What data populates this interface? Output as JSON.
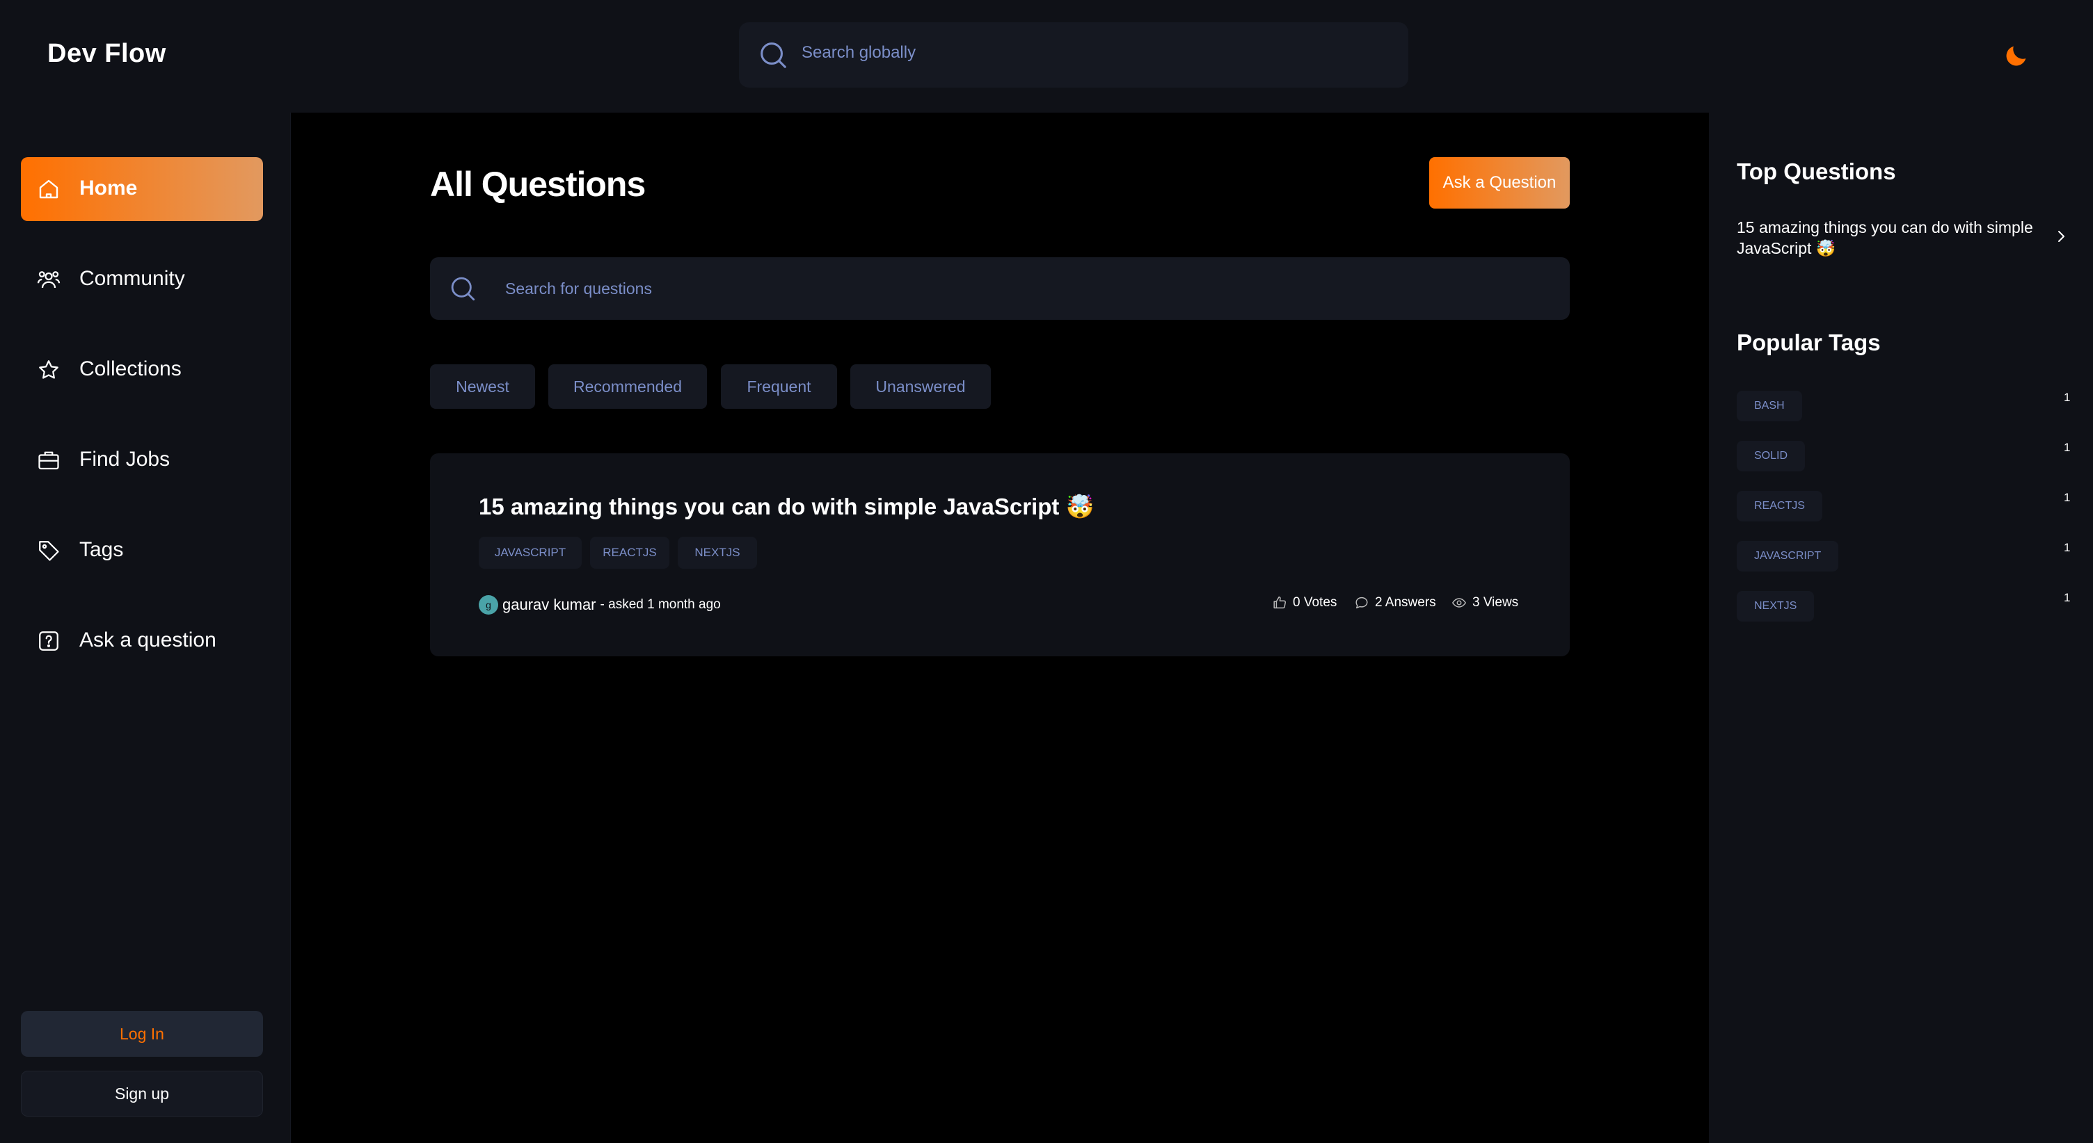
{
  "app": {
    "name": "Dev Flow"
  },
  "header": {
    "search_placeholder": "Search globally"
  },
  "sidebar": {
    "items": [
      {
        "label": "Home",
        "icon": "home-icon",
        "active": true
      },
      {
        "label": "Community",
        "icon": "users-icon",
        "active": false
      },
      {
        "label": "Collections",
        "icon": "star-icon",
        "active": false
      },
      {
        "label": "Find Jobs",
        "icon": "briefcase-icon",
        "active": false
      },
      {
        "label": "Tags",
        "icon": "tag-icon",
        "active": false
      },
      {
        "label": "Ask a question",
        "icon": "question-icon",
        "active": false
      }
    ],
    "login_label": "Log In",
    "signup_label": "Sign up"
  },
  "main": {
    "title": "All Questions",
    "ask_button": "Ask a Question",
    "search_placeholder": "Search for questions",
    "filters": [
      "Newest",
      "Recommended",
      "Frequent",
      "Unanswered"
    ],
    "questions": [
      {
        "title": "15 amazing things you can do with simple JavaScript 🤯",
        "tags": [
          "javascript",
          "reactjs",
          "nextjs"
        ],
        "author": "gaurav kumar",
        "avatar_initial": "g",
        "asked": "- asked 1 month ago",
        "votes": "0 Votes",
        "answers": "2 Answers",
        "views": "3 Views"
      }
    ]
  },
  "right_sidebar": {
    "top_questions_title": "Top Questions",
    "top_questions": [
      "15 amazing things you can do with simple JavaScript 🤯"
    ],
    "popular_tags_title": "Popular Tags",
    "popular_tags": [
      {
        "name": "bash",
        "count": "1"
      },
      {
        "name": "solid",
        "count": "1"
      },
      {
        "name": "reactjs",
        "count": "1"
      },
      {
        "name": "javascript",
        "count": "1"
      },
      {
        "name": "nextjs",
        "count": "1"
      }
    ]
  },
  "colors": {
    "accent": "#ff7000",
    "accent_light": "#e2995f",
    "muted_text": "#7b8ec8"
  }
}
